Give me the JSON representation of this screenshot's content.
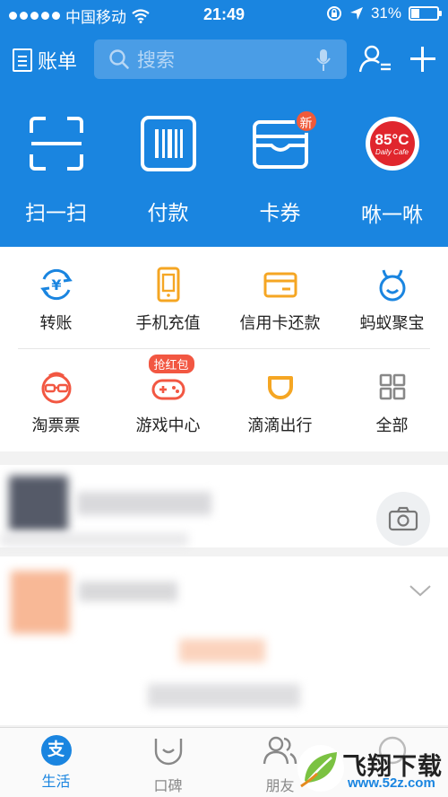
{
  "status_bar": {
    "carrier": "中国移动",
    "time": "21:49",
    "battery": "31%"
  },
  "header": {
    "bill_label": "账单",
    "search_placeholder": "搜索"
  },
  "quick_actions": [
    {
      "label": "扫一扫",
      "icon": "scan-icon"
    },
    {
      "label": "付款",
      "icon": "barcode-icon"
    },
    {
      "label": "卡券",
      "icon": "card-wallet-icon",
      "badge": "新"
    },
    {
      "label": "咻一咻",
      "icon": "85c-cafe-logo"
    }
  ],
  "cafe_logo_text": {
    "main": "85°C",
    "sub": "Daily Cafe"
  },
  "apps": [
    {
      "label": "转账",
      "icon": "transfer-icon",
      "color": "#1a85e0"
    },
    {
      "label": "手机充值",
      "icon": "phone-recharge-icon",
      "color": "#f5a623"
    },
    {
      "label": "信用卡还款",
      "icon": "credit-card-icon",
      "color": "#f5a623"
    },
    {
      "label": "蚂蚁聚宝",
      "icon": "ant-fortune-icon",
      "color": "#1a85e0"
    },
    {
      "label": "淘票票",
      "icon": "taopiaopiao-icon",
      "color": "#f25742"
    },
    {
      "label": "游戏中心",
      "icon": "game-controller-icon",
      "color": "#f25742",
      "badge": "抢红包"
    },
    {
      "label": "滴滴出行",
      "icon": "didi-icon",
      "color": "#f5a623"
    },
    {
      "label": "全部",
      "icon": "all-apps-icon",
      "color": "#888888"
    }
  ],
  "tabs": [
    {
      "label": "生活",
      "icon": "alipay-icon",
      "active": true
    },
    {
      "label": "口碑",
      "icon": "koubei-icon",
      "active": false
    },
    {
      "label": "朋友",
      "icon": "friends-icon",
      "active": false
    },
    {
      "label": "",
      "icon": "profile-icon",
      "active": false
    }
  ],
  "watermark": {
    "title": "飞翔下载",
    "url": "www.52z.com"
  },
  "colors": {
    "brand_blue": "#1a85e0",
    "badge_red": "#f05a3a",
    "cafe_red": "#e0262d"
  }
}
